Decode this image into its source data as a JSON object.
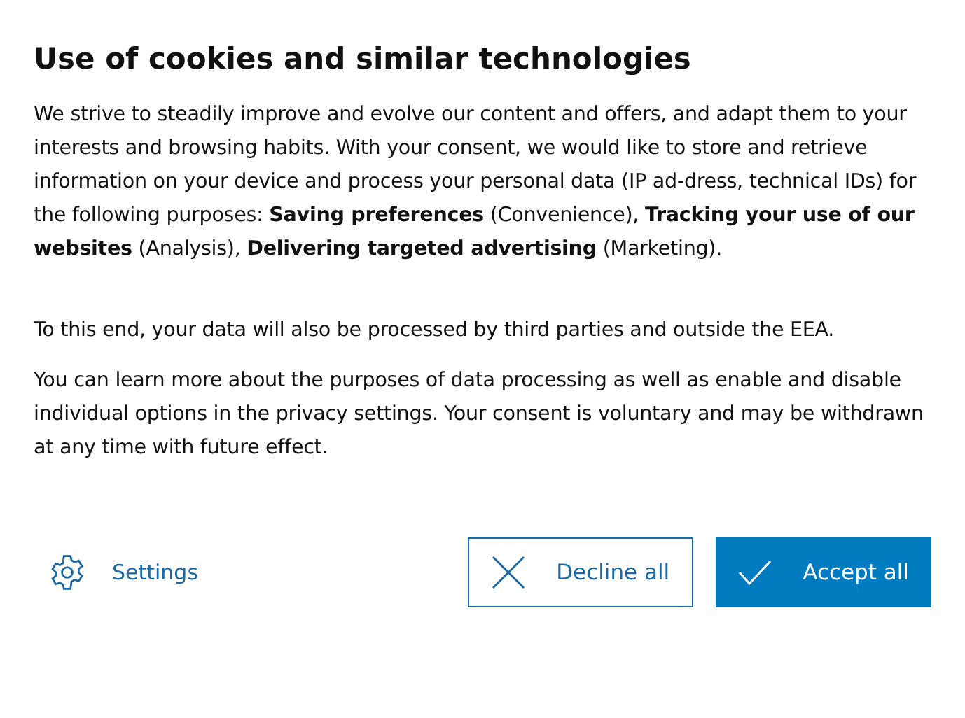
{
  "title": "Use of cookies and similar technologies",
  "paragraphs": [
    "We strive to steadily improve and evolve our content and offers, and adapt them to your interests and browsing habits. With your consent, we would like to store and retrieve information on your device and process your personal data (IP ad-dress, technical IDs) for the following purposes: **Saving preferences** (Convenience), **Tracking your use of our websites** (Analysis), **Delivering targeted advertising** (Marketing).",
    "To this end, your data will also be processed by third parties and outside the EEA.",
    "You can learn more about the purposes of data processing as well as enable and disable individual options in the privacy settings. Your consent is voluntary and may be withdrawn at any time with future effect."
  ],
  "settings_link": "Settings",
  "buttons": [
    {
      "kind": "decline",
      "label": "Decline all"
    },
    {
      "kind": "accept",
      "label": "Accept all"
    }
  ]
}
